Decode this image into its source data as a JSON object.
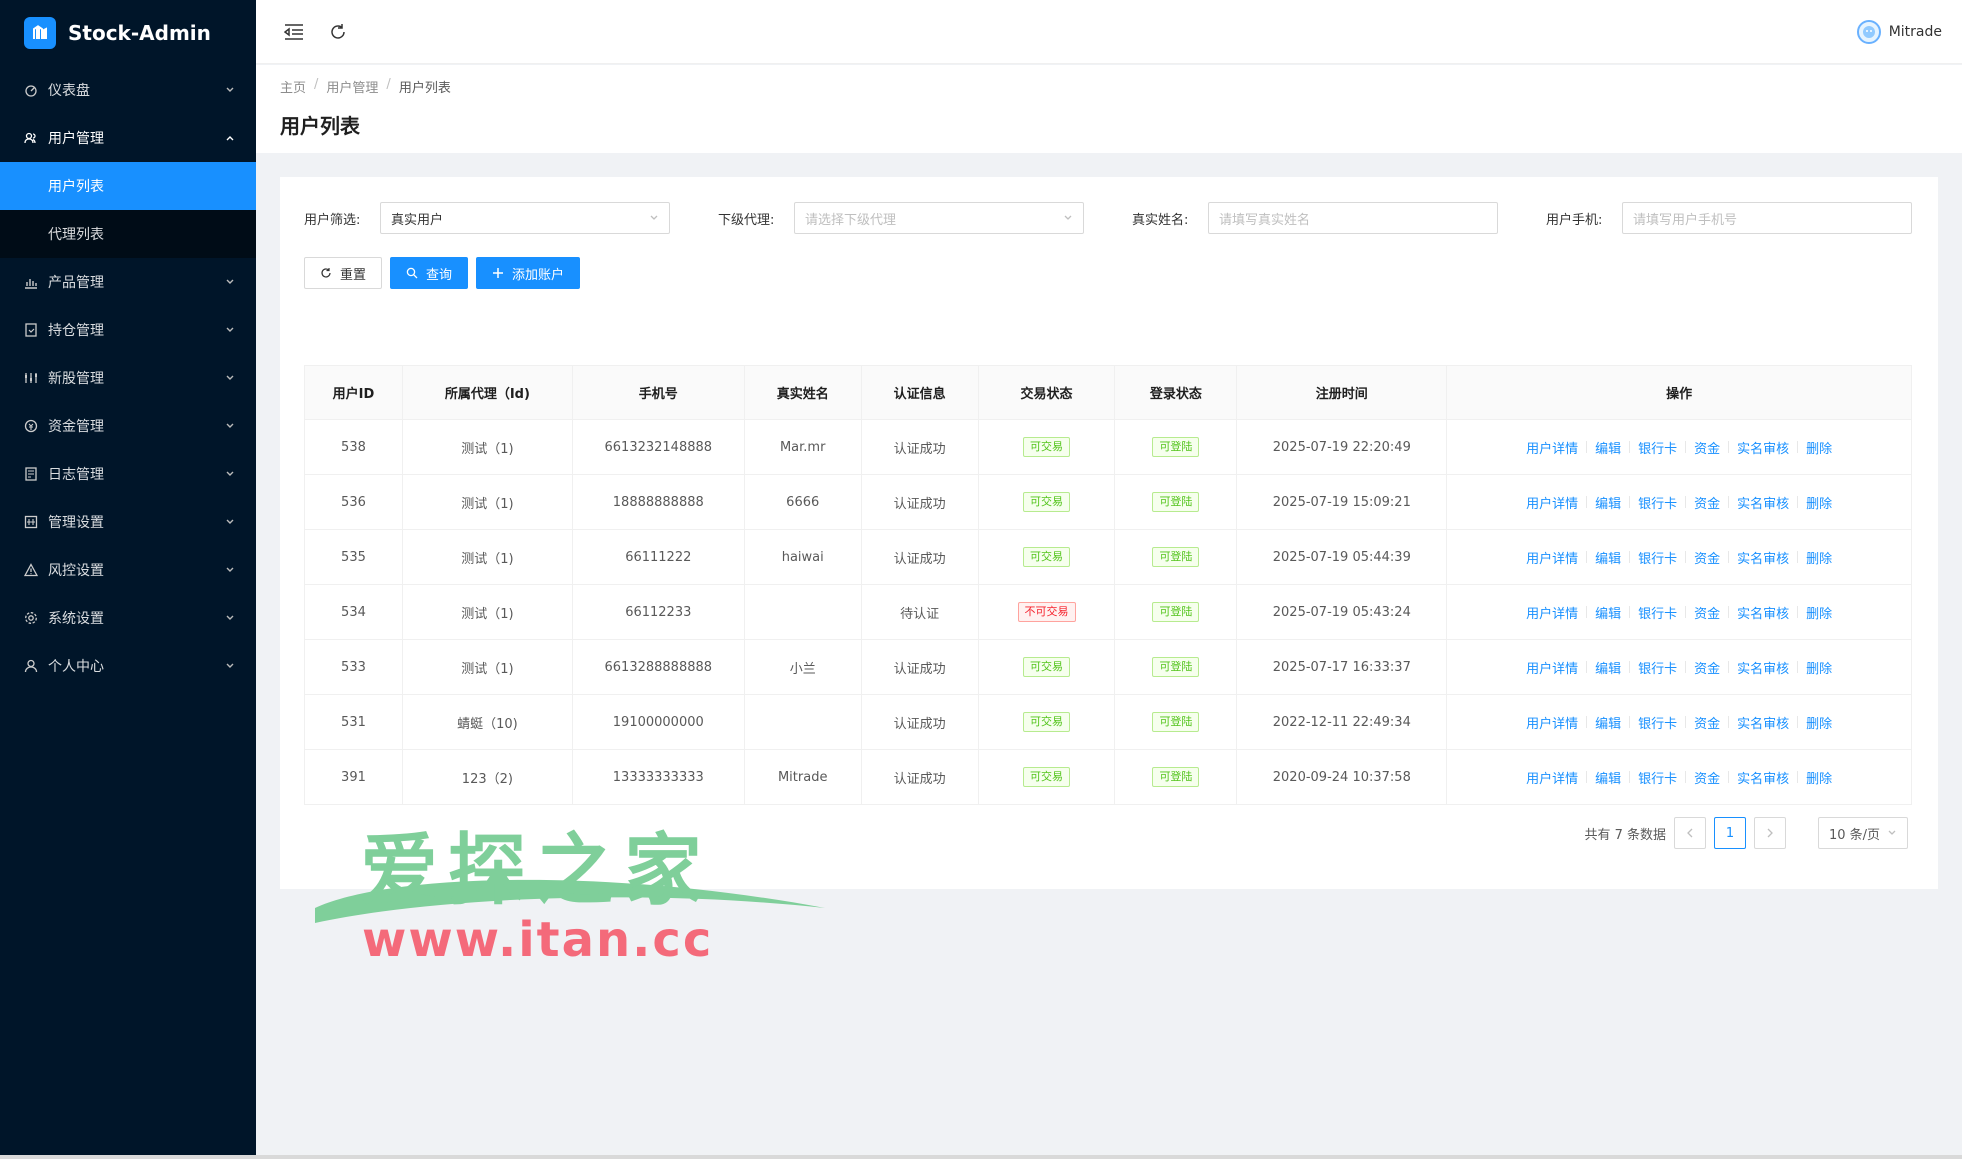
{
  "app": {
    "title": "Stock-Admin"
  },
  "sidebar": {
    "items": [
      {
        "label": "仪表盘",
        "icon": "dashboard-icon"
      },
      {
        "label": "用户管理",
        "icon": "user-group-icon",
        "open": true,
        "children": [
          {
            "label": "用户列表",
            "active": true
          },
          {
            "label": "代理列表"
          }
        ]
      },
      {
        "label": "产品管理",
        "icon": "bar-chart-icon"
      },
      {
        "label": "持仓管理",
        "icon": "file-icon"
      },
      {
        "label": "新股管理",
        "icon": "sliders-icon"
      },
      {
        "label": "资金管理",
        "icon": "money-icon"
      },
      {
        "label": "日志管理",
        "icon": "log-icon"
      },
      {
        "label": "管理设置",
        "icon": "settings-grid-icon"
      },
      {
        "label": "风控设置",
        "icon": "warning-icon"
      },
      {
        "label": "系统设置",
        "icon": "gear-icon"
      },
      {
        "label": "个人中心",
        "icon": "user-icon"
      }
    ]
  },
  "header": {
    "username": "Mitrade"
  },
  "breadcrumb": {
    "home": "主页",
    "parent": "用户管理",
    "current": "用户列表"
  },
  "page": {
    "title": "用户列表"
  },
  "filters": {
    "user_filter": {
      "label": "用户筛选:",
      "value": "真实用户"
    },
    "agent": {
      "label": "下级代理:",
      "placeholder": "请选择下级代理"
    },
    "real_name": {
      "label": "真实姓名:",
      "placeholder": "请填写真实姓名"
    },
    "phone": {
      "label": "用户手机:",
      "placeholder": "请填写用户手机号"
    }
  },
  "buttons": {
    "reset": "重置",
    "search": "查询",
    "add": "添加账户"
  },
  "table": {
    "headers": [
      "用户ID",
      "所属代理（Id)",
      "手机号",
      "真实姓名",
      "认证信息",
      "交易状态",
      "登录状态",
      "注册时间",
      "操作"
    ],
    "ops": [
      "用户详情",
      "编辑",
      "银行卡",
      "资金",
      "实名审核",
      "删除"
    ],
    "rows": [
      {
        "id": "538",
        "agent": "测试（1)",
        "phone": "6613232148888",
        "name": "Mar.mr",
        "auth": "认证成功",
        "trade": "可交易",
        "trade_ok": true,
        "login": "可登陆",
        "time": "2025-07-19 22:20:49"
      },
      {
        "id": "536",
        "agent": "测试（1)",
        "phone": "18888888888",
        "name": "6666",
        "auth": "认证成功",
        "trade": "可交易",
        "trade_ok": true,
        "login": "可登陆",
        "time": "2025-07-19 15:09:21"
      },
      {
        "id": "535",
        "agent": "测试（1)",
        "phone": "66111222",
        "name": "haiwai",
        "auth": "认证成功",
        "trade": "可交易",
        "trade_ok": true,
        "login": "可登陆",
        "time": "2025-07-19 05:44:39"
      },
      {
        "id": "534",
        "agent": "测试（1)",
        "phone": "66112233",
        "name": "",
        "auth": "待认证",
        "trade": "不可交易",
        "trade_ok": false,
        "login": "可登陆",
        "time": "2025-07-19 05:43:24"
      },
      {
        "id": "533",
        "agent": "测试（1)",
        "phone": "6613288888888",
        "name": "小兰",
        "auth": "认证成功",
        "trade": "可交易",
        "trade_ok": true,
        "login": "可登陆",
        "time": "2025-07-17 16:33:37"
      },
      {
        "id": "531",
        "agent": "蜻蜓（10)",
        "phone": "19100000000",
        "name": "",
        "auth": "认证成功",
        "trade": "可交易",
        "trade_ok": true,
        "login": "可登陆",
        "time": "2022-12-11 22:49:34"
      },
      {
        "id": "391",
        "agent": "123（2)",
        "phone": "13333333333",
        "name": "Mitrade",
        "auth": "认证成功",
        "trade": "可交易",
        "trade_ok": true,
        "login": "可登陆",
        "time": "2020-09-24 10:37:58"
      }
    ]
  },
  "pagination": {
    "total_text": "共有 7 条数据",
    "current_page": "1",
    "page_size": "10 条/页"
  },
  "watermark": {
    "text": "爱探之家",
    "url": "www.itan.cc"
  },
  "colors": {
    "primary": "#1890ff",
    "sidebar_bg": "#001529",
    "success": "#52c41a",
    "danger": "#f5222d"
  }
}
